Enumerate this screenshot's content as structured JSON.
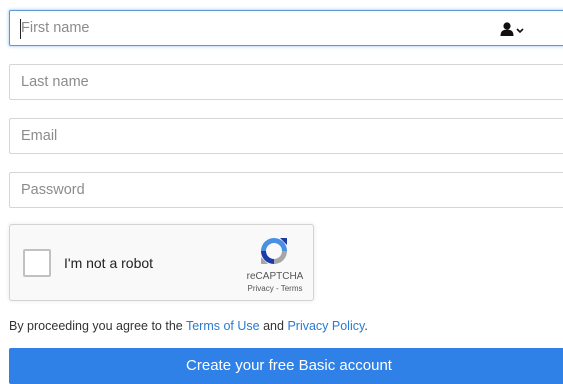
{
  "form": {
    "first_name": {
      "placeholder": "First name",
      "value": ""
    },
    "last_name": {
      "placeholder": "Last name",
      "value": ""
    },
    "email": {
      "placeholder": "Email",
      "value": ""
    },
    "password": {
      "placeholder": "Password",
      "value": ""
    },
    "autofill_icon": "person-with-chevron-icon"
  },
  "captcha": {
    "label": "I'm not a robot",
    "brand": "reCAPTCHA",
    "privacy_link": "Privacy",
    "separator": " - ",
    "terms_link": "Terms",
    "checked": false,
    "logo_icon": "recaptcha-logo-icon"
  },
  "consent": {
    "prefix": "By proceeding you agree to the ",
    "terms_link": "Terms of Use",
    "middle": " and ",
    "privacy_link": "Privacy Policy",
    "suffix": "."
  },
  "submit": {
    "label": "Create your free Basic account"
  },
  "colors": {
    "accent": "#2f80e7",
    "link": "#2a7ad1",
    "focus_border": "#5b9bd5",
    "field_border": "#d6d6d6"
  }
}
